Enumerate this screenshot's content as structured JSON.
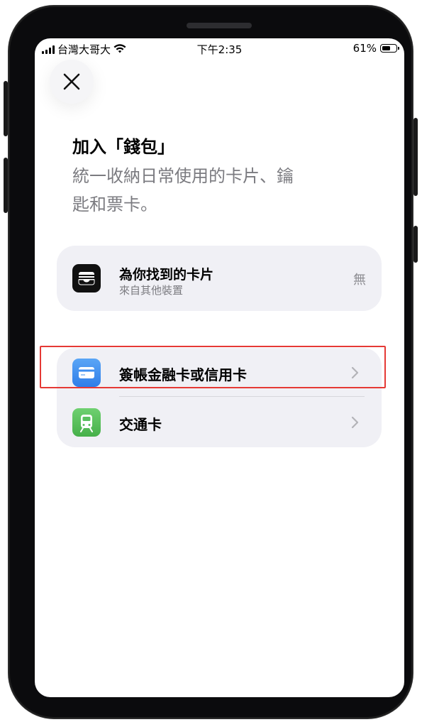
{
  "status_bar": {
    "carrier": "台灣大哥大",
    "time": "下午2:35",
    "battery": "61%",
    "battery_level": 0.61
  },
  "header": {
    "close_icon": "close-icon",
    "title": "加入「錢包」",
    "subtitle": "統一收納日常使用的卡片、鑰匙和票卡。"
  },
  "found_cards": {
    "icon": "wallet-icon",
    "title": "為你找到的卡片",
    "subtitle": "來自其他裝置",
    "value": "無"
  },
  "add_options": [
    {
      "label": "簽帳金融卡或信用卡",
      "icon": "credit-card-icon",
      "icon_color": "#3d8ef0"
    },
    {
      "label": "交通卡",
      "icon": "train-icon",
      "icon_color": "#5ac05f"
    }
  ],
  "highlight_color": "#e53935"
}
